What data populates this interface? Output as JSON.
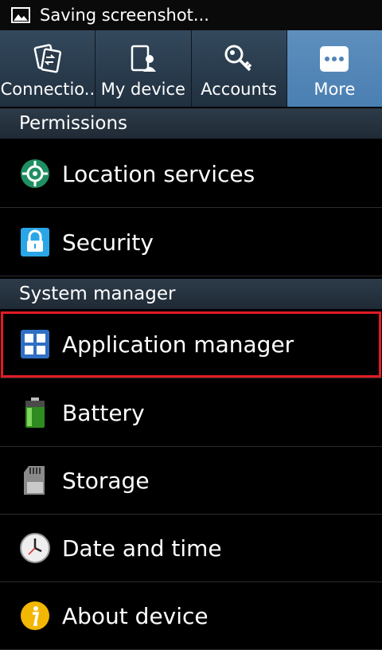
{
  "statusbar": {
    "text": "Saving screenshot..."
  },
  "tabs": [
    {
      "label": "Connectio..",
      "icon": "connections-icon"
    },
    {
      "label": "My device",
      "icon": "my-device-icon"
    },
    {
      "label": "Accounts",
      "icon": "accounts-icon"
    },
    {
      "label": "More",
      "icon": "more-icon",
      "active": true
    }
  ],
  "sections": [
    {
      "title": "Permissions"
    },
    {
      "title": "System manager"
    }
  ],
  "items": [
    {
      "label": "Location services",
      "icon": "location-icon"
    },
    {
      "label": "Security",
      "icon": "lock-icon"
    },
    {
      "label": "Application manager",
      "icon": "app-manager-icon",
      "highlighted": true
    },
    {
      "label": "Battery",
      "icon": "battery-icon"
    },
    {
      "label": "Storage",
      "icon": "storage-icon"
    },
    {
      "label": "Date and time",
      "icon": "clock-icon"
    },
    {
      "label": "About device",
      "icon": "info-icon"
    }
  ],
  "colors": {
    "highlight": "#e01b24",
    "active_tab": "#4f84b6"
  }
}
